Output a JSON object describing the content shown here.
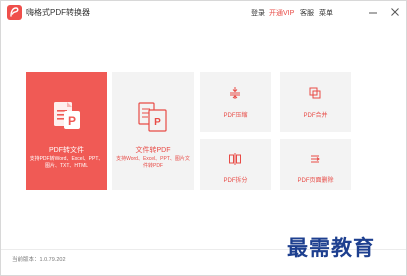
{
  "window": {
    "title": "嗨格式PDF转换器"
  },
  "nav": {
    "login": "登录",
    "vip": "开通VIP",
    "service": "客服",
    "menu": "菜单"
  },
  "tiles": {
    "pdf_to_file": {
      "title": "PDF转文件",
      "desc": "支持PDF转Word、Excel、PPT、图片、TXT、HTML"
    },
    "file_to_pdf": {
      "title": "文件转PDF",
      "desc": "支持Word、Excel、PPT、图片文件转PDF"
    },
    "pdf_compress": {
      "title": "PDF压缩"
    },
    "pdf_merge": {
      "title": "PDF合并"
    },
    "pdf_split": {
      "title": "PDF拆分"
    },
    "pdf_remove_pages": {
      "title": "PDF页面删除"
    }
  },
  "footer": {
    "version": "当前版本：1.0.79.202"
  },
  "watermark": "最需教育",
  "colors": {
    "accent": "#e84b46",
    "tile_bg": "#f3f3f3",
    "brand": "#ef4f4b"
  }
}
